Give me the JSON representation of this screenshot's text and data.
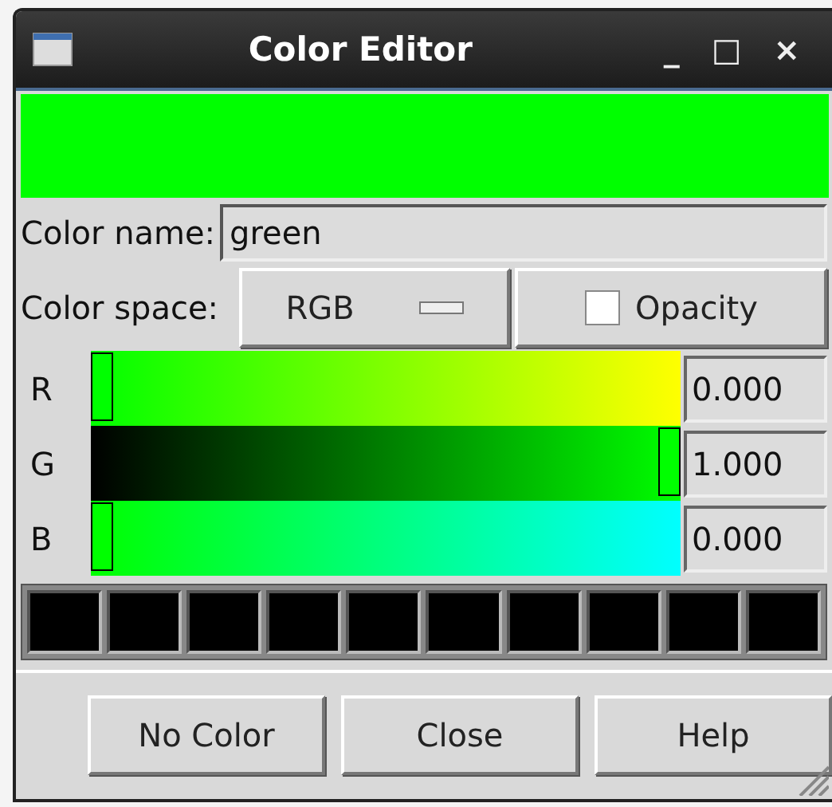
{
  "window": {
    "title": "Color Editor",
    "controls": [
      "_",
      "□",
      "×"
    ]
  },
  "preview": {
    "color": "#00ff00"
  },
  "color_name": {
    "label": "Color name:",
    "value": "green"
  },
  "color_space": {
    "label": "Color space:",
    "value": "RGB"
  },
  "opacity": {
    "label": "Opacity",
    "checked": false
  },
  "channels": [
    {
      "name": "R",
      "level": 0,
      "reading": "0.000"
    },
    {
      "name": "G",
      "level": 1,
      "reading": "1.000"
    },
    {
      "name": "B",
      "level": 0,
      "reading": "0.000"
    }
  ],
  "swatches": [
    {
      "color": "#000000"
    },
    {
      "color": "#000000"
    },
    {
      "color": "#000000"
    },
    {
      "color": "#000000"
    },
    {
      "color": "#000000"
    },
    {
      "color": "#000000"
    },
    {
      "color": "#000000"
    },
    {
      "color": "#000000"
    },
    {
      "color": "#000000"
    },
    {
      "color": "#000000"
    }
  ],
  "buttons": [
    "No Color",
    "Close",
    "Help"
  ]
}
